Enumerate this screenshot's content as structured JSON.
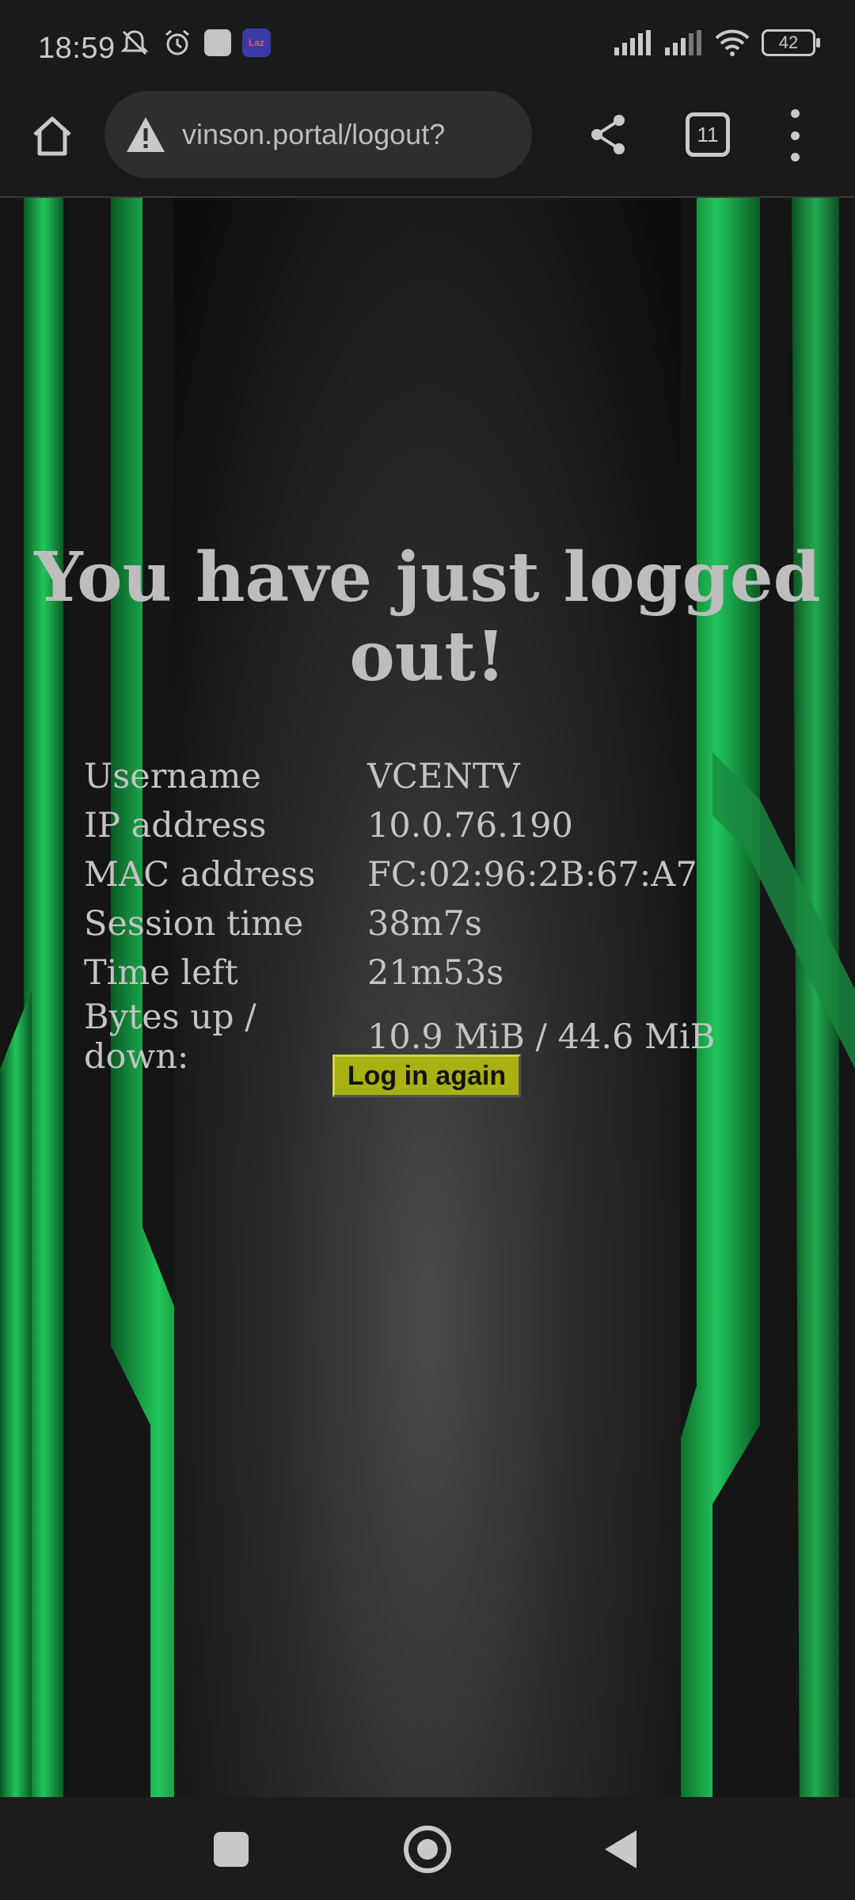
{
  "status_bar": {
    "time": "18:59",
    "battery": "42",
    "icons_left": [
      "mute-icon",
      "alarm-icon",
      "app-icon",
      "lazada-icon"
    ],
    "icons_right": [
      "signal-1-icon",
      "signal-2-icon",
      "wifi-icon",
      "battery-icon"
    ],
    "lazada_label": "Laz"
  },
  "browser": {
    "url": "vinson.portal/logout?",
    "tab_count": "11"
  },
  "page": {
    "title": "You have just logged out!",
    "rows": [
      {
        "label": "Username",
        "value": "VCENTV"
      },
      {
        "label": "IP address",
        "value": "10.0.76.190"
      },
      {
        "label": "MAC address",
        "value": "FC:02:96:2B:67:A7"
      },
      {
        "label": "Session time",
        "value": "38m7s"
      },
      {
        "label": "Time left",
        "value": "21m53s"
      },
      {
        "label": "Bytes up / down:",
        "value": "10.9 MiB / 44.6 MiB"
      }
    ],
    "login_button": "Log in again"
  },
  "theme": {
    "accent_green": "#1fa84a",
    "button_color": "#a8b012"
  }
}
